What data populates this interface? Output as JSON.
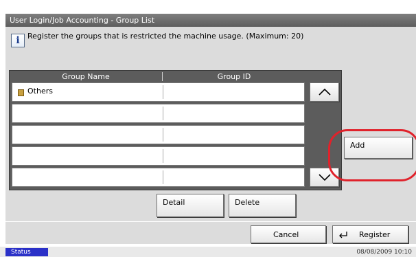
{
  "window": {
    "title": "User Login/Job Accounting - Group List"
  },
  "info": {
    "icon": "info-icon",
    "message": "Register the groups that is restricted the machine usage. (Maximum: 20)"
  },
  "list": {
    "columns": {
      "group_name": "Group Name",
      "group_id": "Group ID"
    },
    "rows": [
      {
        "name": "Others",
        "id": ""
      },
      {
        "name": "",
        "id": ""
      },
      {
        "name": "",
        "id": ""
      },
      {
        "name": "",
        "id": ""
      },
      {
        "name": "",
        "id": ""
      }
    ]
  },
  "buttons": {
    "add": "Add",
    "detail": "Detail",
    "delete": "Delete",
    "cancel": "Cancel",
    "register": "Register"
  },
  "status": {
    "badge": "Status",
    "datetime": "08/08/2009  10:10"
  }
}
